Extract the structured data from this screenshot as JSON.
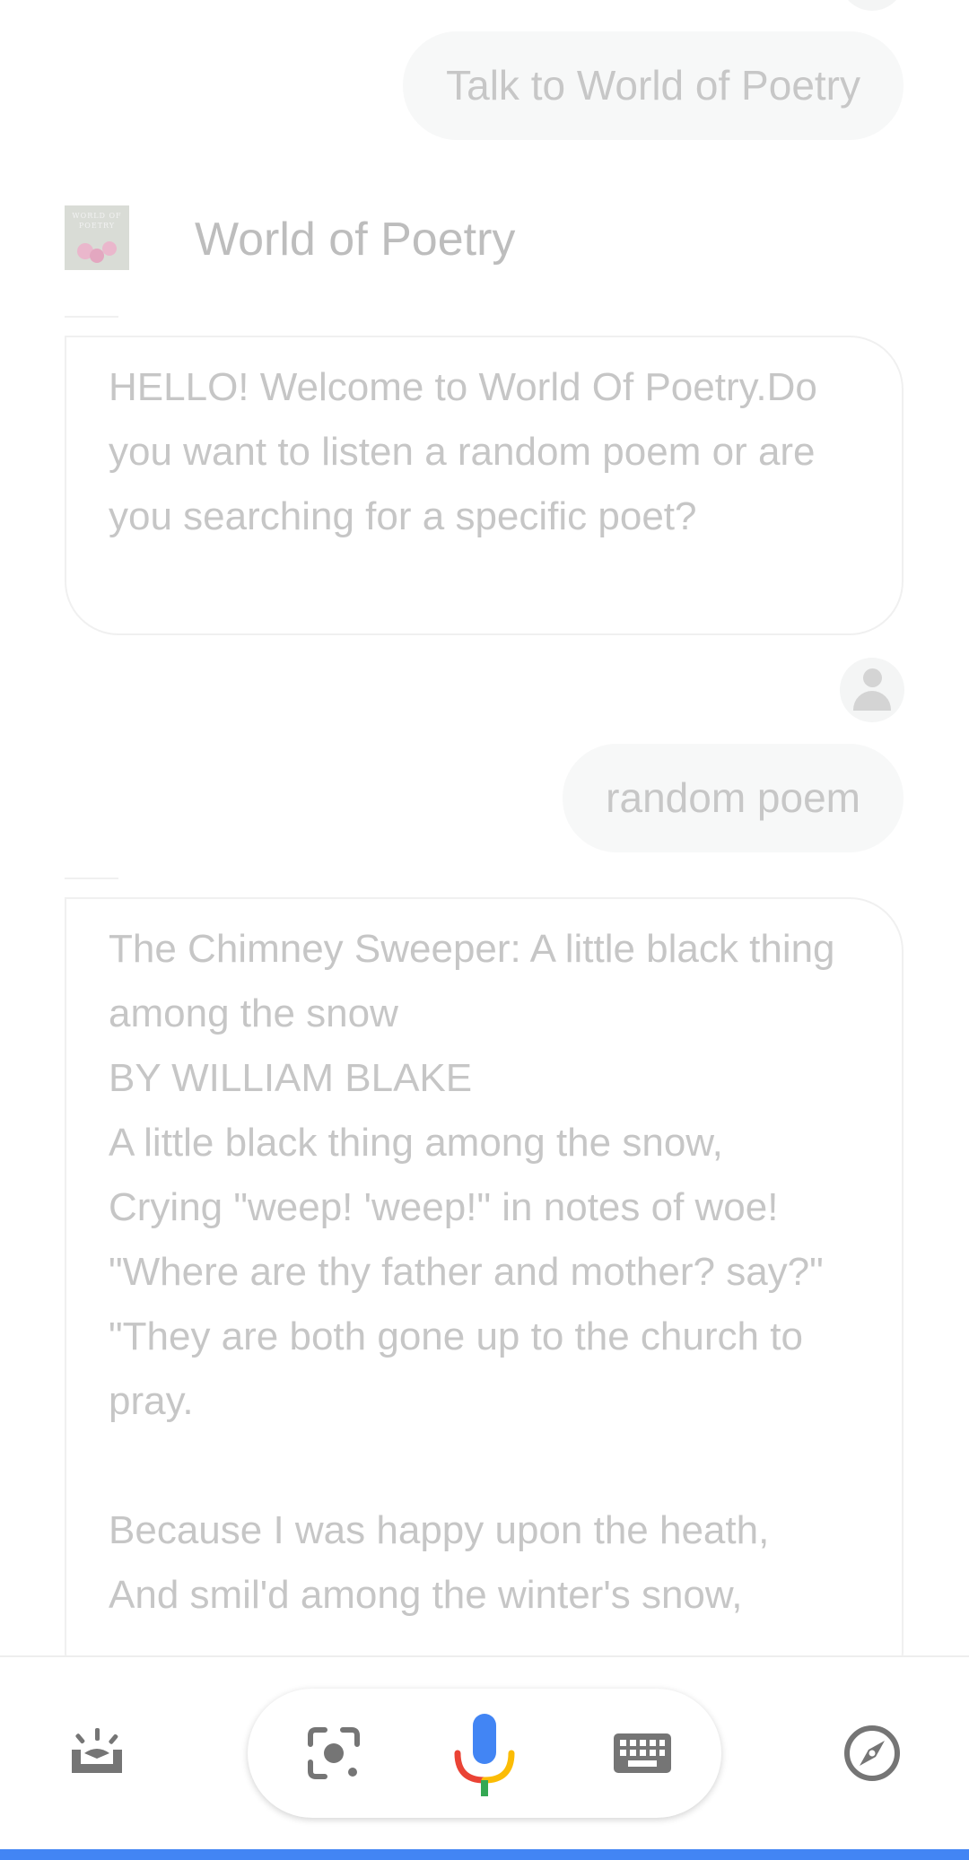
{
  "conversation": {
    "user_query": "Talk to World of Poetry",
    "action_name": "World of Poetry",
    "action_logo_text": "WORLD OF POETRY",
    "bot_greeting": "HELLO!  Welcome to World Of Poetry.Do you want to listen a random poem or are you searching for a specific poet?",
    "user_reply": "random poem",
    "bot_poem": "The Chimney Sweeper: A little black thing among the snow\nBY WILLIAM BLAKE\nA little black thing among the snow,\nCrying \"weep! 'weep!\" in notes of woe!\n\"Where are thy father and mother? say?\"\n\"They are both gone up to the church to pray.\n\nBecause I was happy upon the heath,\nAnd smil'd among the winter's snow,"
  },
  "bottom_bar": {
    "icons": [
      "updates-tray-icon",
      "lens-icon",
      "microphone-icon",
      "keyboard-icon",
      "compass-icon"
    ]
  },
  "colors": {
    "accent_blue": "#4285f4",
    "mic_blue": "#4285f4",
    "mic_red": "#ea4335",
    "mic_yellow": "#fbbc05",
    "mic_green": "#34a853",
    "icon_gray": "#757575"
  }
}
